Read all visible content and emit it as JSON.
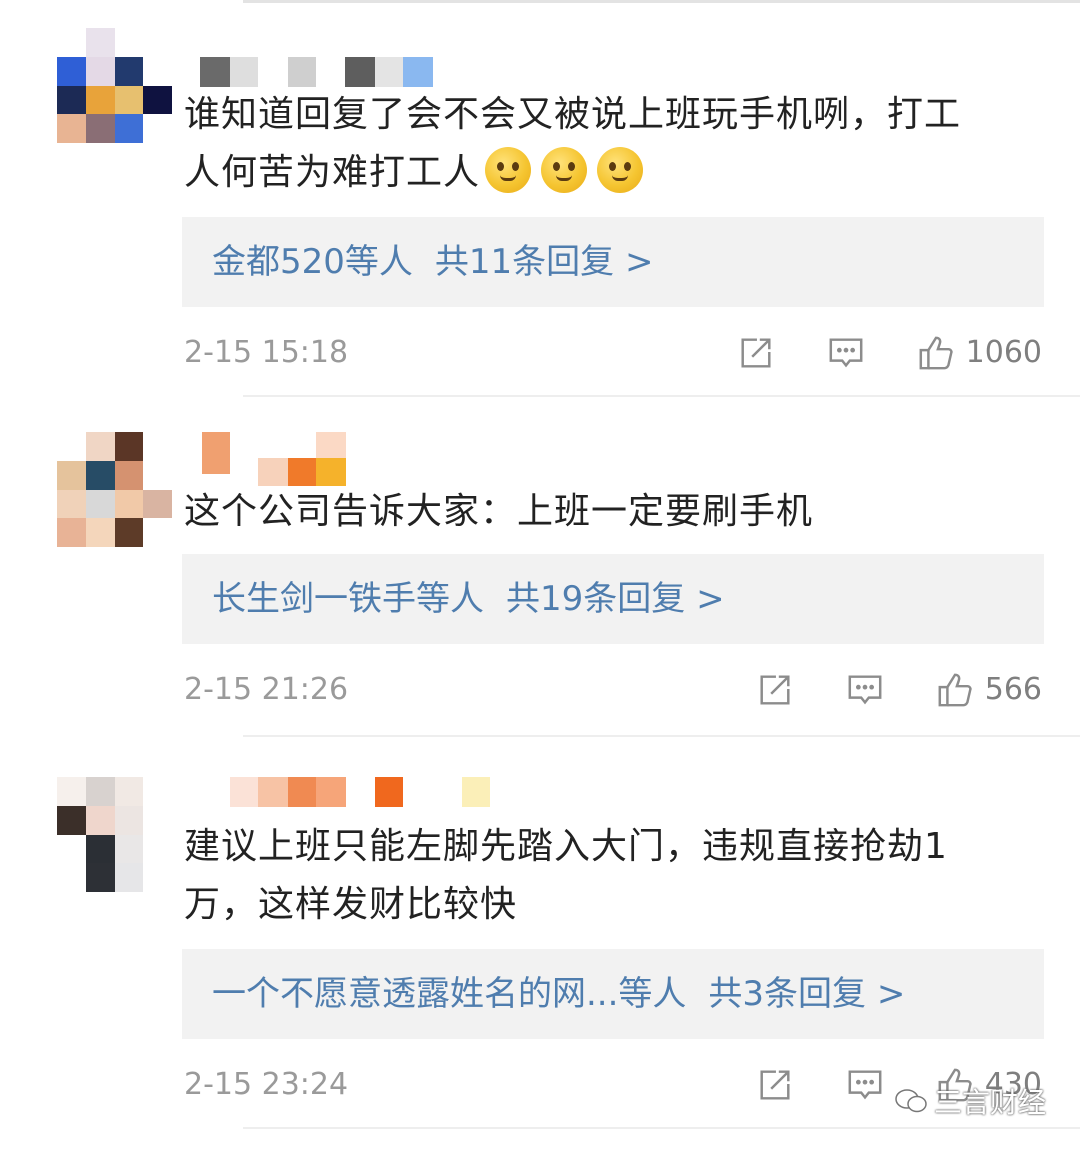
{
  "comments": [
    {
      "text_line1": "谁知道回复了会不会又被说上班玩手机咧，打工",
      "text_line2": "人何苦为难打工人",
      "emoji_icon": "thinking-face-icon",
      "replies_users": "金都520等人",
      "replies_count": "共11条回复 >",
      "time": "2-15 15:18",
      "likes": "1060"
    },
    {
      "text_line1": "这个公司告诉大家：上班一定要刷手机",
      "replies_users": "长生剑一铁手等人",
      "replies_count": "共19条回复 >",
      "time": "2-15 21:26",
      "likes": "566"
    },
    {
      "text_line1": "建议上班只能左脚先踏入大门，违规直接抢劫1",
      "text_line2": "万，这样发财比较快",
      "replies_users": "一个不愿意透露姓名的网...等人",
      "replies_count": "共3条回复 >",
      "time": "2-15 23:24",
      "likes": "430"
    }
  ],
  "watermark": {
    "text": "三言财经"
  },
  "colors": {
    "link": "#4f7dae",
    "text": "#222222",
    "meta": "#9a9a9a",
    "reply_bg": "#f2f2f2"
  }
}
